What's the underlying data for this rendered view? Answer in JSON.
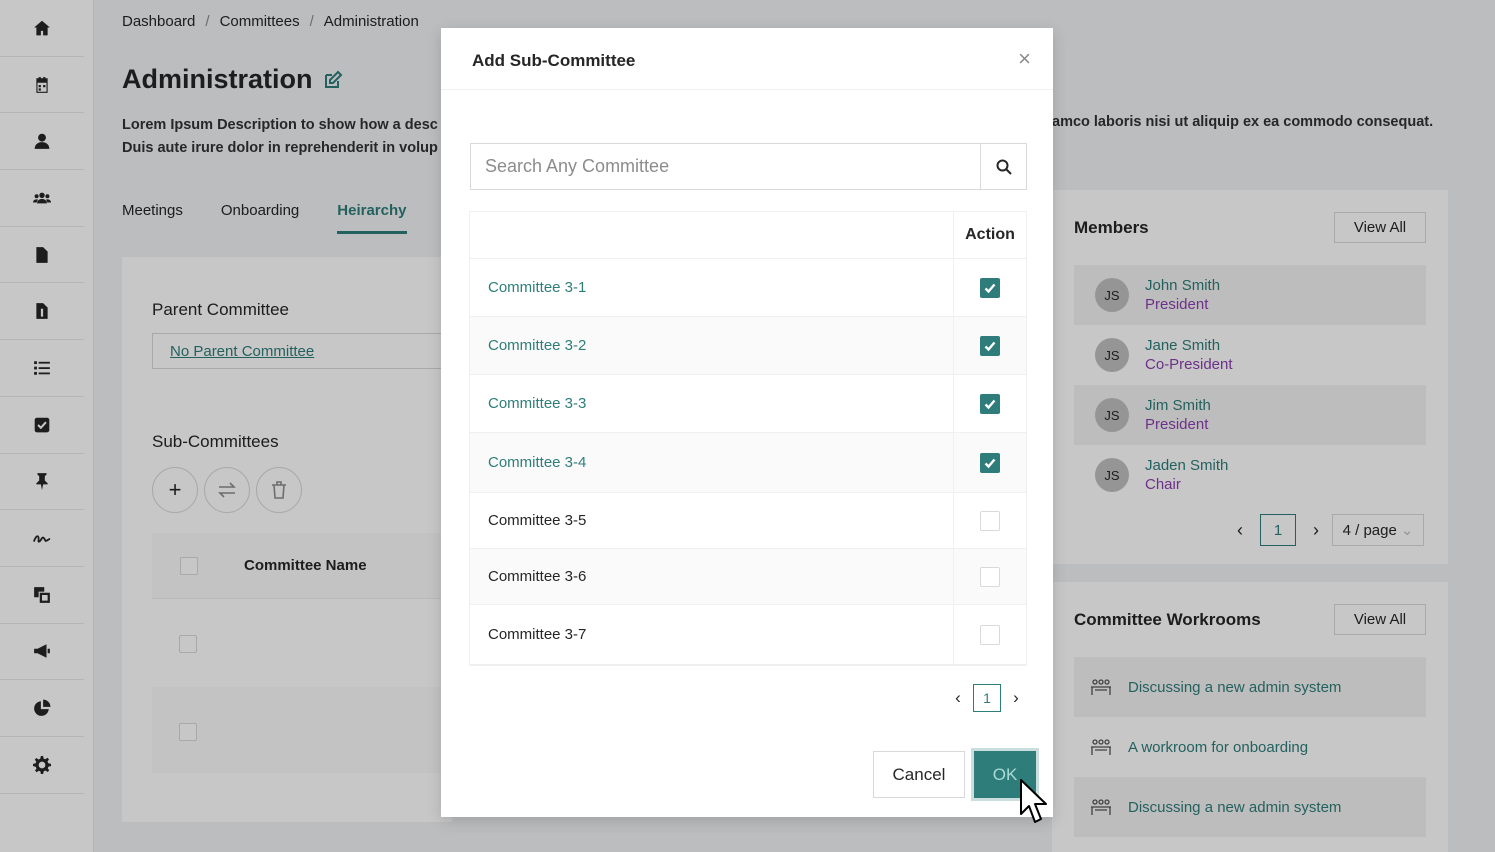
{
  "sidebar": {
    "items": [
      {
        "icon": "home-icon"
      },
      {
        "icon": "calendar-icon"
      },
      {
        "icon": "user-icon"
      },
      {
        "icon": "users-icon"
      },
      {
        "icon": "file-icon"
      },
      {
        "icon": "invoice-icon"
      },
      {
        "icon": "list-icon"
      },
      {
        "icon": "checkbox-icon"
      },
      {
        "icon": "pin-icon"
      },
      {
        "icon": "signature-icon"
      },
      {
        "icon": "clone-icon"
      },
      {
        "icon": "megaphone-icon"
      },
      {
        "icon": "pie-chart-icon"
      },
      {
        "icon": "gear-icon"
      }
    ]
  },
  "breadcrumb": [
    "Dashboard",
    "Committees",
    "Administration"
  ],
  "breadcrumb_sep": "/",
  "page": {
    "title": "Administration",
    "description_left_1": "Lorem Ipsum Description to show how a desc",
    "description_left_2": "Duis aute irure dolor in reprehenderit in volup",
    "description_right": "amco laboris nisi ut aliquip ex ea commodo consequat."
  },
  "tabs": [
    "Meetings",
    "Onboarding",
    "Heirarchy"
  ],
  "hierarchy": {
    "parent_label": "Parent Committee",
    "parent_value": "No Parent Committee",
    "sub_label": "Sub-Committees",
    "add_symbol": "+",
    "column_name": "Committee Name"
  },
  "members": {
    "title": "Members",
    "view_all": "View All",
    "list": [
      {
        "initials": "JS",
        "name": "John Smith",
        "role": "President"
      },
      {
        "initials": "JS",
        "name": "Jane Smith",
        "role": "Co-President"
      },
      {
        "initials": "JS",
        "name": "Jim Smith",
        "role": "President"
      },
      {
        "initials": "JS",
        "name": "Jaden Smith",
        "role": "Chair"
      }
    ],
    "page": "1",
    "per_page": "4 / page"
  },
  "workrooms": {
    "title": "Committee Workrooms",
    "view_all": "View All",
    "list": [
      "Discussing a new admin system",
      "A workroom for onboarding",
      "Discussing a new admin system"
    ]
  },
  "modal": {
    "title": "Add Sub-Committee",
    "close": "×",
    "search_placeholder": "Search Any Committee",
    "action_header": "Action",
    "rows": [
      {
        "name": "Committee 3-1",
        "checked": true
      },
      {
        "name": "Committee 3-2",
        "checked": true
      },
      {
        "name": "Committee 3-3",
        "checked": true
      },
      {
        "name": "Committee 3-4",
        "checked": true
      },
      {
        "name": "Committee 3-5",
        "checked": false
      },
      {
        "name": "Committee 3-6",
        "checked": false
      },
      {
        "name": "Committee 3-7",
        "checked": false
      }
    ],
    "page": "1",
    "cancel": "Cancel",
    "ok": "OK"
  },
  "colors": {
    "accent": "#2e7d7a",
    "role": "#8b3fb0"
  }
}
